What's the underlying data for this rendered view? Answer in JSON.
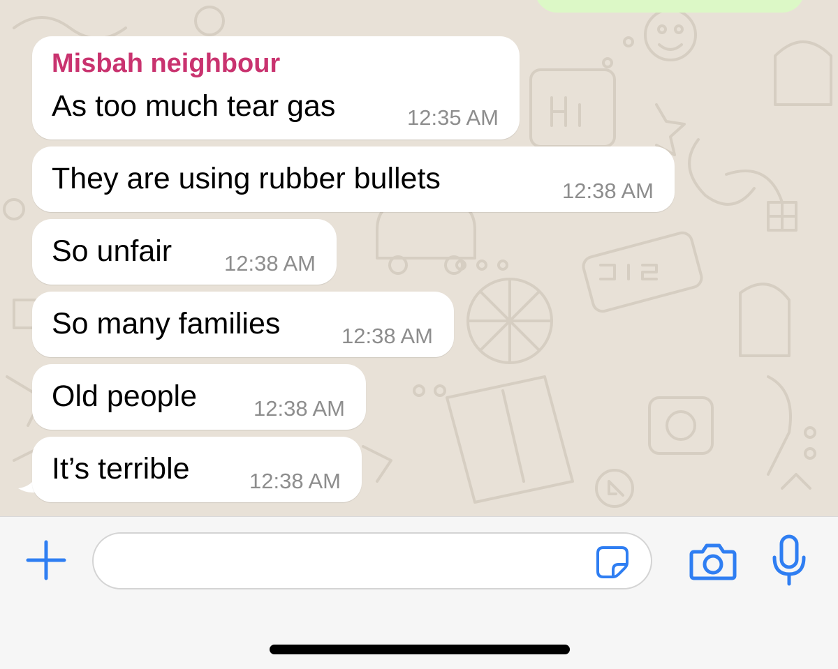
{
  "chat": {
    "sender_name": "Misbah neighbour",
    "messages": [
      {
        "text": "As too much tear gas",
        "time": "12:35 AM"
      },
      {
        "text": "They are using rubber bullets",
        "time": "12:38 AM"
      },
      {
        "text": "So unfair",
        "time": "12:38 AM"
      },
      {
        "text": "So many families",
        "time": "12:38 AM"
      },
      {
        "text": "Old people",
        "time": "12:38 AM"
      },
      {
        "text": "It’s terrible",
        "time": "12:38 AM"
      }
    ]
  },
  "composer": {
    "input_value": "",
    "icons": [
      "plus-icon",
      "sticker-icon",
      "camera-icon",
      "microphone-icon"
    ]
  },
  "colors": {
    "accent": "#2f7ef2",
    "sender_name": "#c9336f",
    "outgoing_bubble": "#dcf8c6",
    "incoming_bubble": "#ffffff",
    "chat_background": "#e8e1d7",
    "timestamp": "#8d8d8d"
  }
}
